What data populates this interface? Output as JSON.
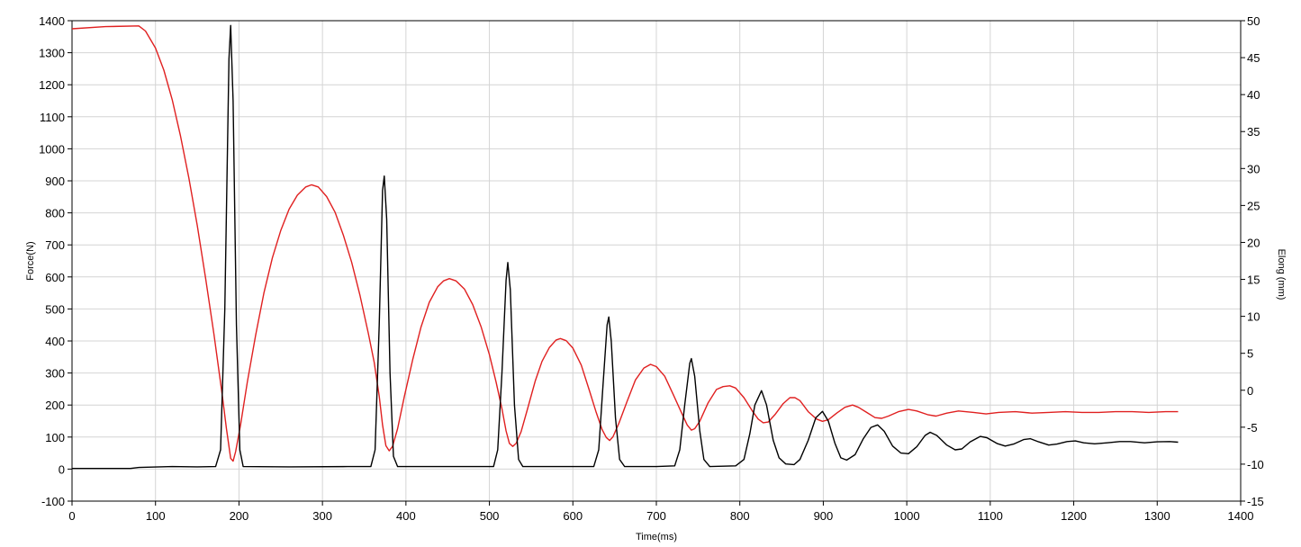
{
  "chart_data": {
    "type": "line",
    "xlabel": "Time(ms)",
    "ylabel_left": "Force(N)",
    "ylabel_right": "Elong (mm)",
    "xlim": [
      0,
      1400
    ],
    "ylim_left": [
      -100,
      1400
    ],
    "ylim_right": [
      -15,
      50
    ],
    "x_ticks": [
      0,
      100,
      200,
      300,
      400,
      500,
      600,
      700,
      800,
      900,
      1000,
      1100,
      1200,
      1300,
      1400
    ],
    "y_ticks_left": [
      -100,
      0,
      100,
      200,
      300,
      400,
      500,
      600,
      700,
      800,
      900,
      1000,
      1100,
      1200,
      1300,
      1400
    ],
    "y_ticks_right": [
      -15,
      -10,
      -5,
      0,
      5,
      10,
      15,
      20,
      25,
      30,
      35,
      40,
      45,
      50
    ],
    "grid": true,
    "legend": "none",
    "series": [
      {
        "axis": "left",
        "color": "#000000",
        "points": [
          [
            0,
            2
          ],
          [
            70,
            2
          ],
          [
            80,
            5
          ],
          [
            120,
            8
          ],
          [
            150,
            7
          ],
          [
            172,
            8
          ],
          [
            178,
            60
          ],
          [
            183,
            500
          ],
          [
            188,
            1280
          ],
          [
            190,
            1385
          ],
          [
            193,
            1150
          ],
          [
            197,
            450
          ],
          [
            201,
            60
          ],
          [
            205,
            8
          ],
          [
            260,
            7
          ],
          [
            330,
            8
          ],
          [
            358,
            8
          ],
          [
            363,
            60
          ],
          [
            368,
            450
          ],
          [
            372,
            870
          ],
          [
            374,
            915
          ],
          [
            377,
            780
          ],
          [
            381,
            300
          ],
          [
            385,
            40
          ],
          [
            390,
            8
          ],
          [
            450,
            8
          ],
          [
            505,
            8
          ],
          [
            510,
            60
          ],
          [
            515,
            300
          ],
          [
            520,
            590
          ],
          [
            522,
            645
          ],
          [
            525,
            560
          ],
          [
            530,
            200
          ],
          [
            535,
            30
          ],
          [
            540,
            8
          ],
          [
            600,
            8
          ],
          [
            625,
            8
          ],
          [
            631,
            60
          ],
          [
            636,
            260
          ],
          [
            641,
            450
          ],
          [
            643,
            475
          ],
          [
            646,
            400
          ],
          [
            651,
            160
          ],
          [
            656,
            30
          ],
          [
            662,
            8
          ],
          [
            700,
            8
          ],
          [
            722,
            10
          ],
          [
            728,
            60
          ],
          [
            734,
            200
          ],
          [
            740,
            330
          ],
          [
            742,
            345
          ],
          [
            746,
            290
          ],
          [
            752,
            120
          ],
          [
            757,
            30
          ],
          [
            764,
            8
          ],
          [
            795,
            10
          ],
          [
            805,
            30
          ],
          [
            812,
            110
          ],
          [
            818,
            200
          ],
          [
            826,
            245
          ],
          [
            832,
            200
          ],
          [
            840,
            90
          ],
          [
            847,
            35
          ],
          [
            855,
            16
          ],
          [
            865,
            14
          ],
          [
            872,
            30
          ],
          [
            882,
            90
          ],
          [
            891,
            160
          ],
          [
            899,
            180
          ],
          [
            906,
            150
          ],
          [
            914,
            80
          ],
          [
            921,
            35
          ],
          [
            928,
            28
          ],
          [
            938,
            45
          ],
          [
            948,
            95
          ],
          [
            957,
            130
          ],
          [
            965,
            138
          ],
          [
            973,
            118
          ],
          [
            983,
            72
          ],
          [
            993,
            50
          ],
          [
            1002,
            48
          ],
          [
            1012,
            70
          ],
          [
            1022,
            105
          ],
          [
            1028,
            115
          ],
          [
            1036,
            105
          ],
          [
            1048,
            75
          ],
          [
            1058,
            60
          ],
          [
            1066,
            63
          ],
          [
            1076,
            85
          ],
          [
            1088,
            102
          ],
          [
            1096,
            98
          ],
          [
            1108,
            80
          ],
          [
            1118,
            72
          ],
          [
            1128,
            78
          ],
          [
            1140,
            92
          ],
          [
            1148,
            95
          ],
          [
            1158,
            85
          ],
          [
            1170,
            75
          ],
          [
            1180,
            78
          ],
          [
            1192,
            86
          ],
          [
            1202,
            88
          ],
          [
            1212,
            82
          ],
          [
            1225,
            79
          ],
          [
            1240,
            82
          ],
          [
            1255,
            86
          ],
          [
            1268,
            86
          ],
          [
            1285,
            82
          ],
          [
            1300,
            85
          ],
          [
            1315,
            86
          ],
          [
            1325,
            84
          ]
        ]
      },
      {
        "axis": "right",
        "color": "#e02020",
        "points": [
          [
            0,
            48.9
          ],
          [
            40,
            49.2
          ],
          [
            80,
            49.3
          ],
          [
            88,
            48.6
          ],
          [
            100,
            46.3
          ],
          [
            110,
            43.3
          ],
          [
            120,
            39.3
          ],
          [
            130,
            34.4
          ],
          [
            140,
            28.7
          ],
          [
            150,
            22.3
          ],
          [
            160,
            15.2
          ],
          [
            170,
            7.6
          ],
          [
            180,
            -0.7
          ],
          [
            185,
            -5.2
          ],
          [
            190,
            -9.2
          ],
          [
            193,
            -9.6
          ],
          [
            196,
            -8.3
          ],
          [
            202,
            -4.6
          ],
          [
            210,
            1.1
          ],
          [
            220,
            7.5
          ],
          [
            230,
            13.2
          ],
          [
            240,
            17.9
          ],
          [
            250,
            21.6
          ],
          [
            260,
            24.5
          ],
          [
            270,
            26.4
          ],
          [
            280,
            27.5
          ],
          [
            287,
            27.8
          ],
          [
            295,
            27.5
          ],
          [
            305,
            26.2
          ],
          [
            315,
            24.1
          ],
          [
            325,
            21.0
          ],
          [
            335,
            17.3
          ],
          [
            345,
            12.8
          ],
          [
            355,
            7.7
          ],
          [
            362,
            3.8
          ],
          [
            368,
            -0.8
          ],
          [
            372,
            -4.7
          ],
          [
            376,
            -7.5
          ],
          [
            380,
            -8.2
          ],
          [
            384,
            -7.6
          ],
          [
            390,
            -5.2
          ],
          [
            398,
            -0.9
          ],
          [
            408,
            4.1
          ],
          [
            418,
            8.5
          ],
          [
            428,
            11.9
          ],
          [
            438,
            14.0
          ],
          [
            445,
            14.8
          ],
          [
            452,
            15.1
          ],
          [
            460,
            14.8
          ],
          [
            470,
            13.7
          ],
          [
            480,
            11.6
          ],
          [
            490,
            8.6
          ],
          [
            500,
            4.8
          ],
          [
            508,
            1.1
          ],
          [
            515,
            -2.5
          ],
          [
            520,
            -5.5
          ],
          [
            524,
            -7.2
          ],
          [
            528,
            -7.6
          ],
          [
            532,
            -7.2
          ],
          [
            538,
            -5.6
          ],
          [
            546,
            -2.4
          ],
          [
            555,
            1.3
          ],
          [
            563,
            3.9
          ],
          [
            572,
            5.8
          ],
          [
            580,
            6.8
          ],
          [
            585,
            7.0
          ],
          [
            592,
            6.7
          ],
          [
            600,
            5.7
          ],
          [
            610,
            3.4
          ],
          [
            620,
            -0.1
          ],
          [
            628,
            -3.0
          ],
          [
            635,
            -5.3
          ],
          [
            640,
            -6.4
          ],
          [
            644,
            -6.8
          ],
          [
            648,
            -6.3
          ],
          [
            655,
            -4.5
          ],
          [
            665,
            -1.5
          ],
          [
            675,
            1.4
          ],
          [
            685,
            3.0
          ],
          [
            693,
            3.5
          ],
          [
            700,
            3.2
          ],
          [
            710,
            1.9
          ],
          [
            720,
            -0.5
          ],
          [
            730,
            -3.0
          ],
          [
            737,
            -4.7
          ],
          [
            742,
            -5.4
          ],
          [
            746,
            -5.2
          ],
          [
            752,
            -4.2
          ],
          [
            762,
            -1.7
          ],
          [
            772,
            0.1
          ],
          [
            780,
            0.5
          ],
          [
            788,
            0.6
          ],
          [
            795,
            0.3
          ],
          [
            805,
            -1.0
          ],
          [
            815,
            -2.8
          ],
          [
            822,
            -3.9
          ],
          [
            828,
            -4.4
          ],
          [
            834,
            -4.3
          ],
          [
            842,
            -3.3
          ],
          [
            852,
            -1.8
          ],
          [
            860,
            -1.0
          ],
          [
            866,
            -1.0
          ],
          [
            872,
            -1.4
          ],
          [
            882,
            -2.9
          ],
          [
            892,
            -3.9
          ],
          [
            899,
            -4.2
          ],
          [
            906,
            -4.0
          ],
          [
            916,
            -3.1
          ],
          [
            926,
            -2.3
          ],
          [
            935,
            -2.0
          ],
          [
            942,
            -2.3
          ],
          [
            952,
            -3.0
          ],
          [
            962,
            -3.7
          ],
          [
            970,
            -3.8
          ],
          [
            978,
            -3.5
          ],
          [
            990,
            -2.9
          ],
          [
            1002,
            -2.6
          ],
          [
            1012,
            -2.8
          ],
          [
            1025,
            -3.3
          ],
          [
            1035,
            -3.5
          ],
          [
            1048,
            -3.1
          ],
          [
            1062,
            -2.8
          ],
          [
            1080,
            -3.0
          ],
          [
            1095,
            -3.2
          ],
          [
            1110,
            -3.0
          ],
          [
            1130,
            -2.9
          ],
          [
            1150,
            -3.1
          ],
          [
            1170,
            -3.0
          ],
          [
            1190,
            -2.9
          ],
          [
            1210,
            -3.0
          ],
          [
            1230,
            -3.0
          ],
          [
            1250,
            -2.9
          ],
          [
            1270,
            -2.9
          ],
          [
            1290,
            -3.0
          ],
          [
            1310,
            -2.9
          ],
          [
            1325,
            -2.9
          ]
        ]
      }
    ]
  }
}
